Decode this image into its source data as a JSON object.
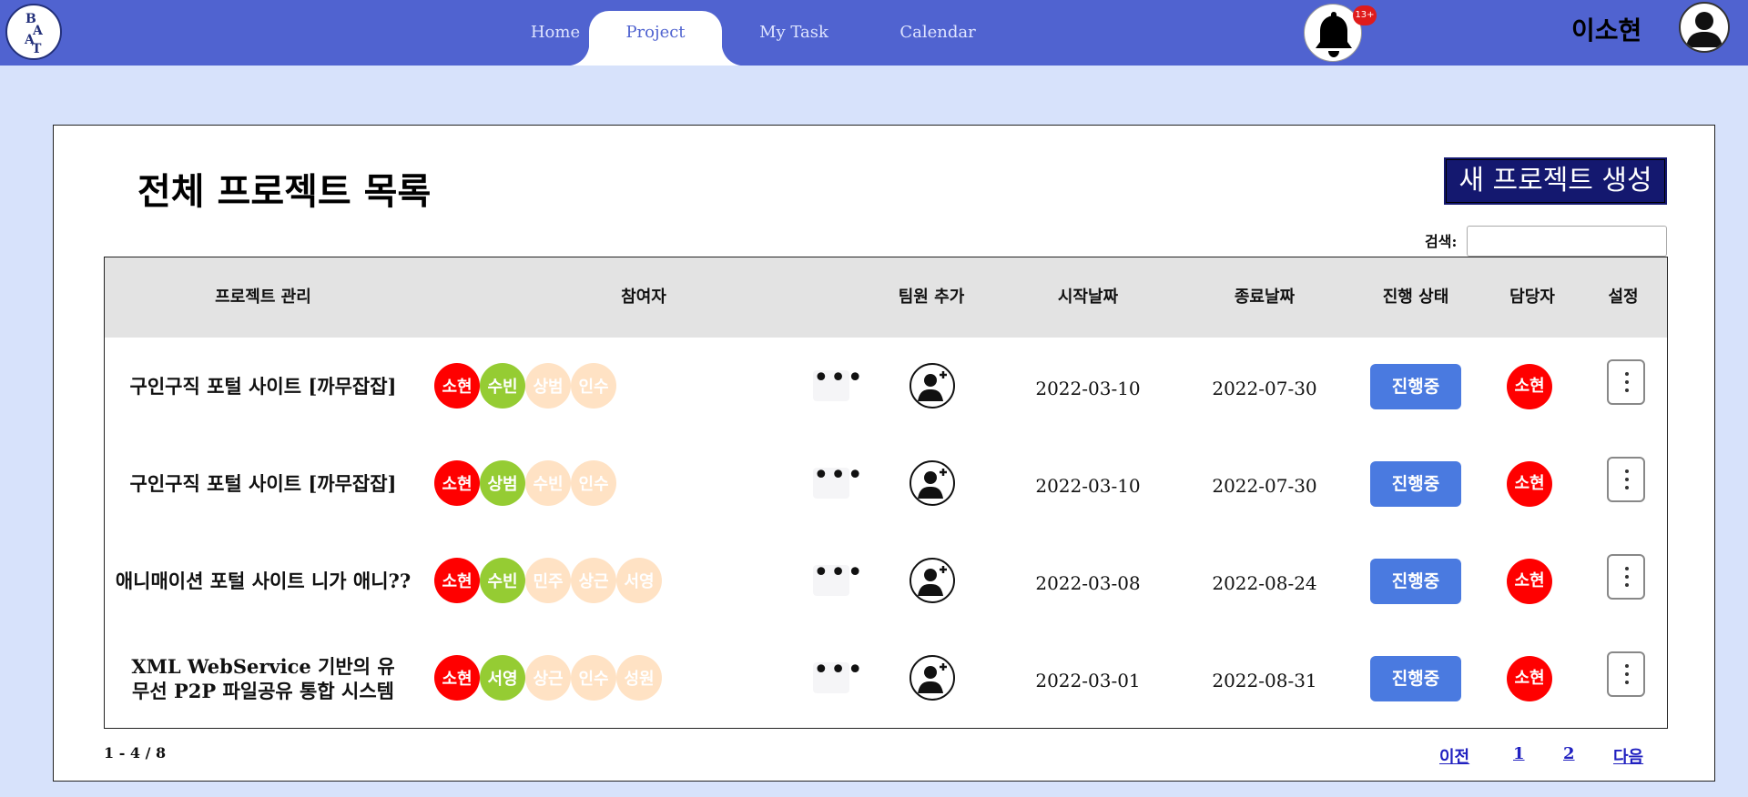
{
  "nav": {
    "tabs": [
      {
        "label": "Home"
      },
      {
        "label": "Project"
      },
      {
        "label": "My Task"
      },
      {
        "label": "Calendar"
      }
    ],
    "active_tab": "Project",
    "notification_count": "13+",
    "username": "이소현"
  },
  "page": {
    "title": "전체 프로젝트 목록",
    "new_project_button": "새 프로젝트 생성",
    "search_label": "검색:",
    "search_value": ""
  },
  "table": {
    "headers": [
      "프로젝트 관리",
      "참여자",
      "팀원 추가",
      "시작날짜",
      "종료날짜",
      "진행 상태",
      "담당자",
      "설정"
    ],
    "rows": [
      {
        "name": "구인구직 포털 사이트 [까무잡잡]",
        "members": [
          "소현",
          "수빈",
          "상범",
          "인수"
        ],
        "start": "2022-03-10",
        "end": "2022-07-30",
        "status": "진행중",
        "owner": "소현"
      },
      {
        "name": "구인구직 포털 사이트 [까무잡잡]",
        "members": [
          "소현",
          "상범",
          "수빈",
          "인수"
        ],
        "start": "2022-03-10",
        "end": "2022-07-30",
        "status": "진행중",
        "owner": "소현"
      },
      {
        "name": "애니매이션 포털 사이트 니가 애니??",
        "members": [
          "소현",
          "수빈",
          "민주",
          "상근",
          "서영"
        ],
        "start": "2022-03-08",
        "end": "2022-08-24",
        "status": "진행중",
        "owner": "소현"
      },
      {
        "name": "XML WebService 기반의 유무선 P2P 파일공유 통합 시스템",
        "members": [
          "소현",
          "서영",
          "상근",
          "인수",
          "성원"
        ],
        "start": "2022-03-01",
        "end": "2022-08-31",
        "status": "진행중",
        "owner": "소현"
      }
    ]
  },
  "pagination": {
    "info": "1 - 4 / 8",
    "prev": "이전",
    "pages": [
      "1",
      "2"
    ],
    "next": "다음"
  },
  "colors": {
    "nav_bg": "#5063d0",
    "page_bg": "#d7e2fb",
    "primary_button": "#14186f",
    "status_button": "#4a7ae0",
    "chip_owner": "#ff0000",
    "chip_second": "#95cc33",
    "chip_rest": "#ffe2c4"
  }
}
